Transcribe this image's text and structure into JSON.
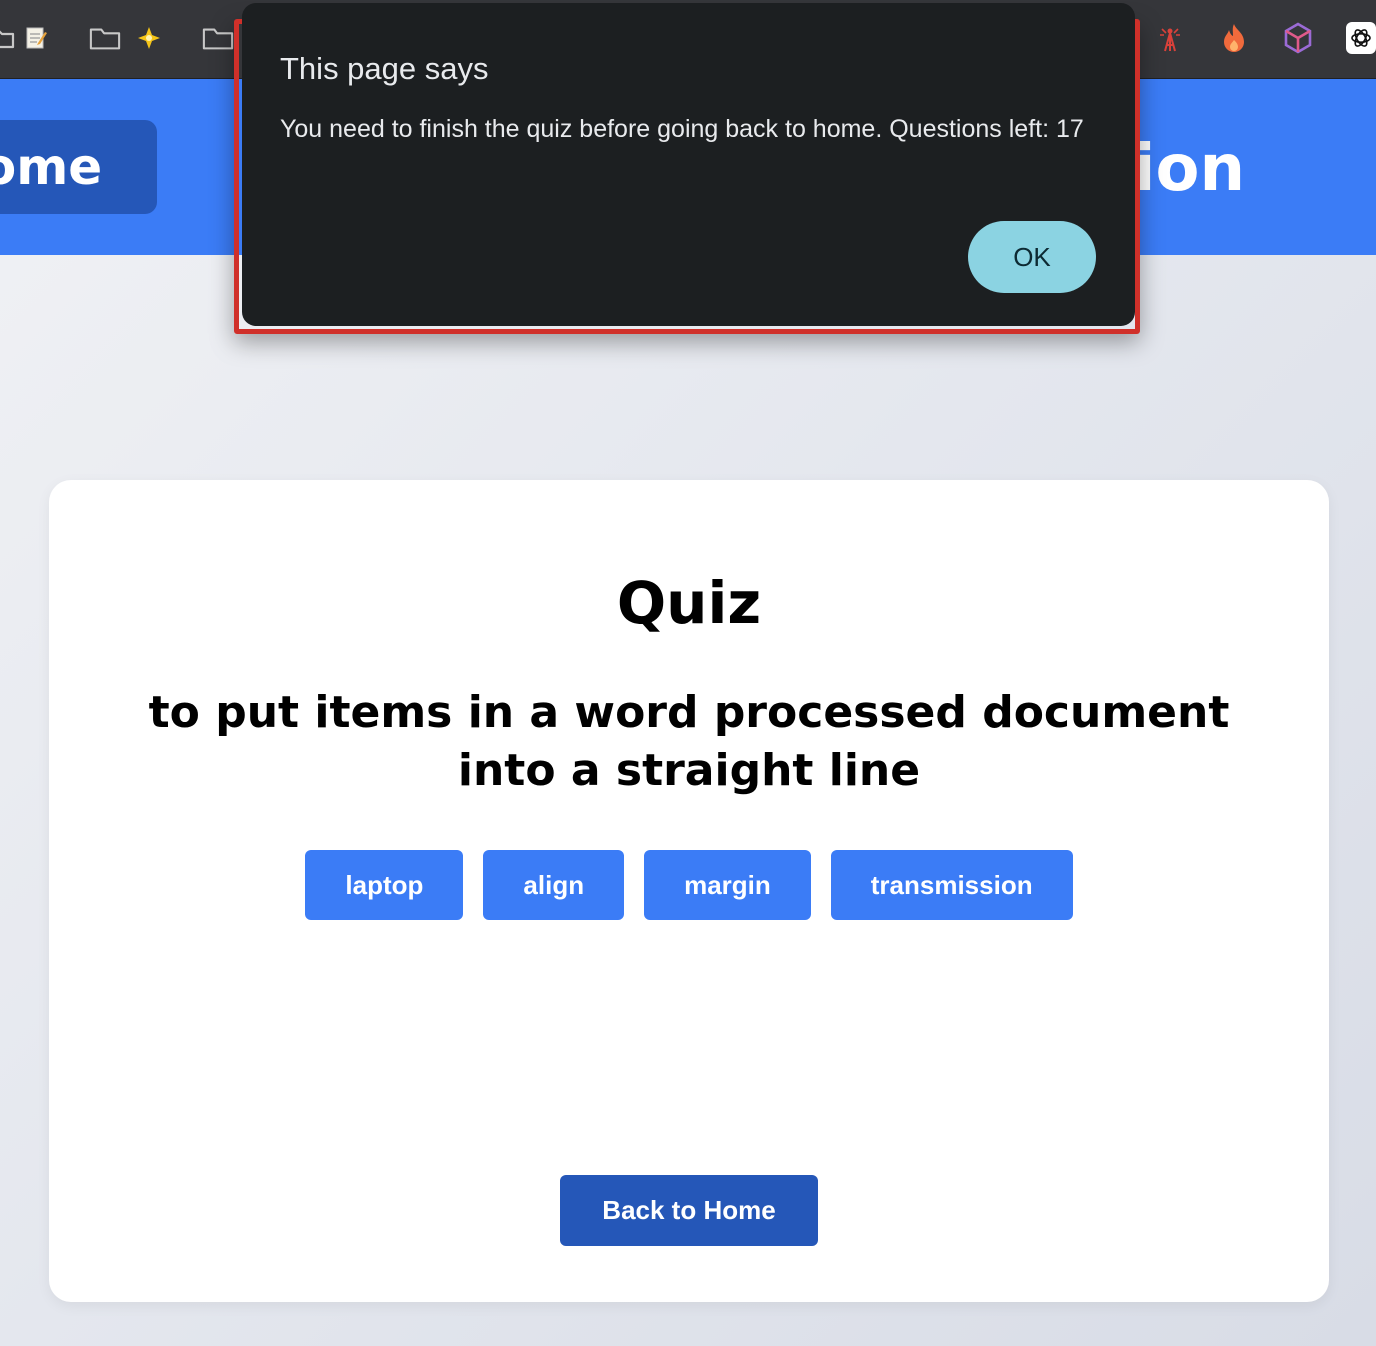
{
  "browser": {
    "icons": [
      "folder-icon",
      "notepad-icon",
      "folder-icon",
      "star-icon",
      "folder-icon",
      "antenna-icon",
      "fire-icon",
      "cube-icon",
      "openai-icon"
    ]
  },
  "header": {
    "home_label": "Home",
    "title_visible": "tion"
  },
  "quiz": {
    "title": "Quiz",
    "question": "to put items in a word processed document into a straight line",
    "answers": [
      "laptop",
      "align",
      "margin",
      "transmission"
    ],
    "back_label": "Back to Home"
  },
  "dialog": {
    "title": "This page says",
    "message": "You need to finish the quiz before going back to home. Questions left: 17",
    "ok_label": "OK"
  },
  "colors": {
    "accent": "#3b7cf6",
    "accent_dark": "#2557b8",
    "dialog_bg": "#1c1f21",
    "ok_button": "#8bd3e2",
    "highlight_border": "#d0302a"
  }
}
